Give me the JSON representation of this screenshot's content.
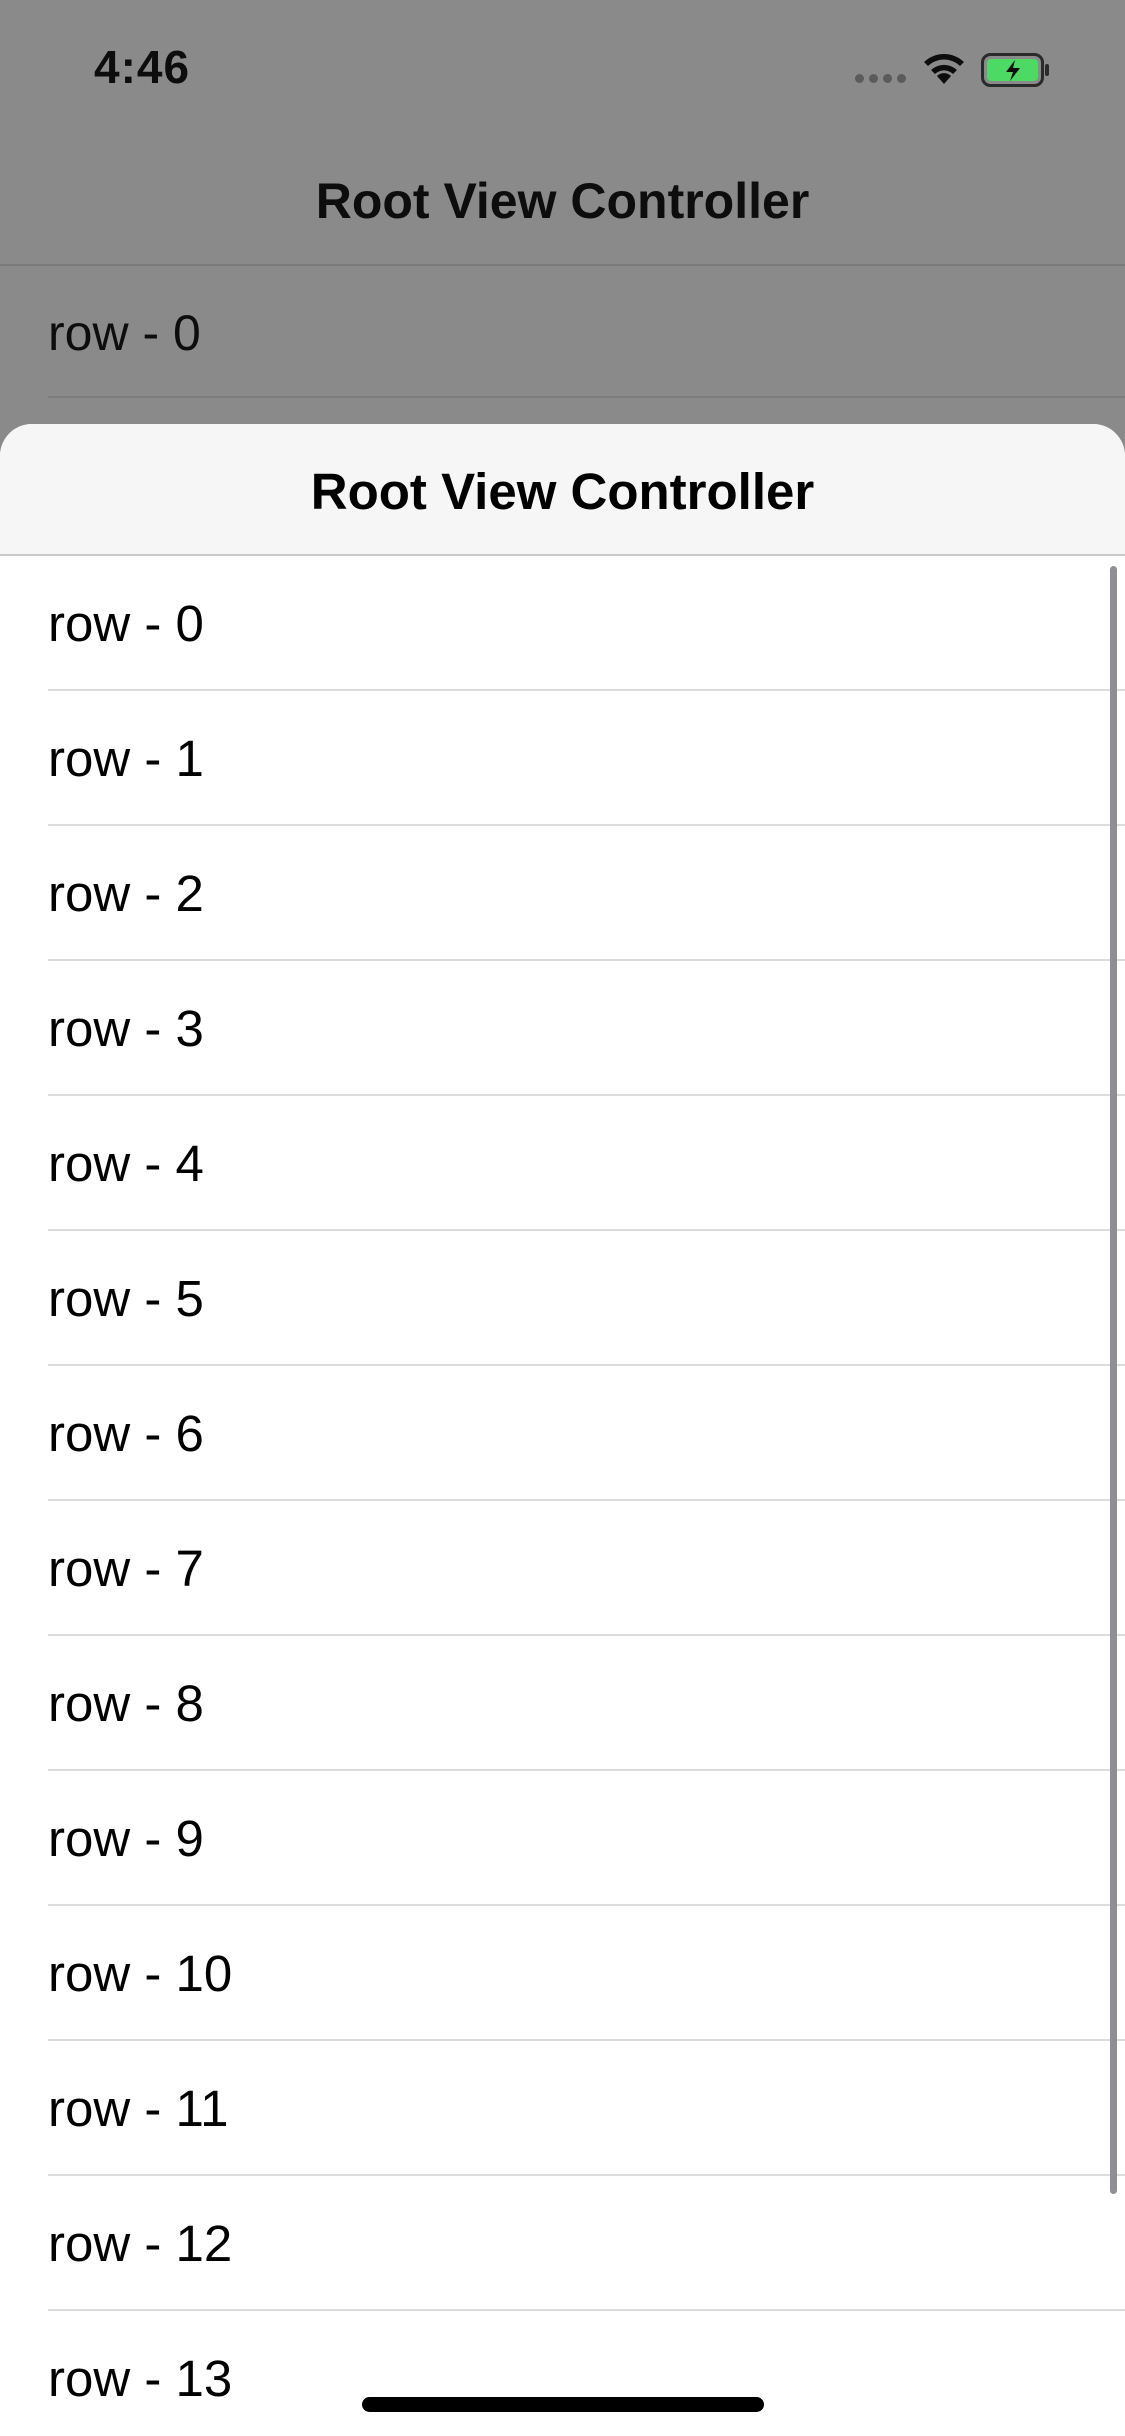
{
  "status_bar": {
    "time": "4:46",
    "icons": [
      "signal-icon",
      "wifi-icon",
      "battery-charging-icon"
    ],
    "battery_color": "#4cd964"
  },
  "background_screen": {
    "nav_title": "Root View Controller",
    "rows": [
      {
        "label": "row - 0"
      }
    ]
  },
  "sheet": {
    "nav_title": "Root View Controller",
    "rows": [
      {
        "label": "row - 0"
      },
      {
        "label": "row - 1"
      },
      {
        "label": "row - 2"
      },
      {
        "label": "row - 3"
      },
      {
        "label": "row - 4"
      },
      {
        "label": "row - 5"
      },
      {
        "label": "row - 6"
      },
      {
        "label": "row - 7"
      },
      {
        "label": "row - 8"
      },
      {
        "label": "row - 9"
      },
      {
        "label": "row - 10"
      },
      {
        "label": "row - 11"
      },
      {
        "label": "row - 12"
      },
      {
        "label": "row - 13"
      }
    ]
  }
}
